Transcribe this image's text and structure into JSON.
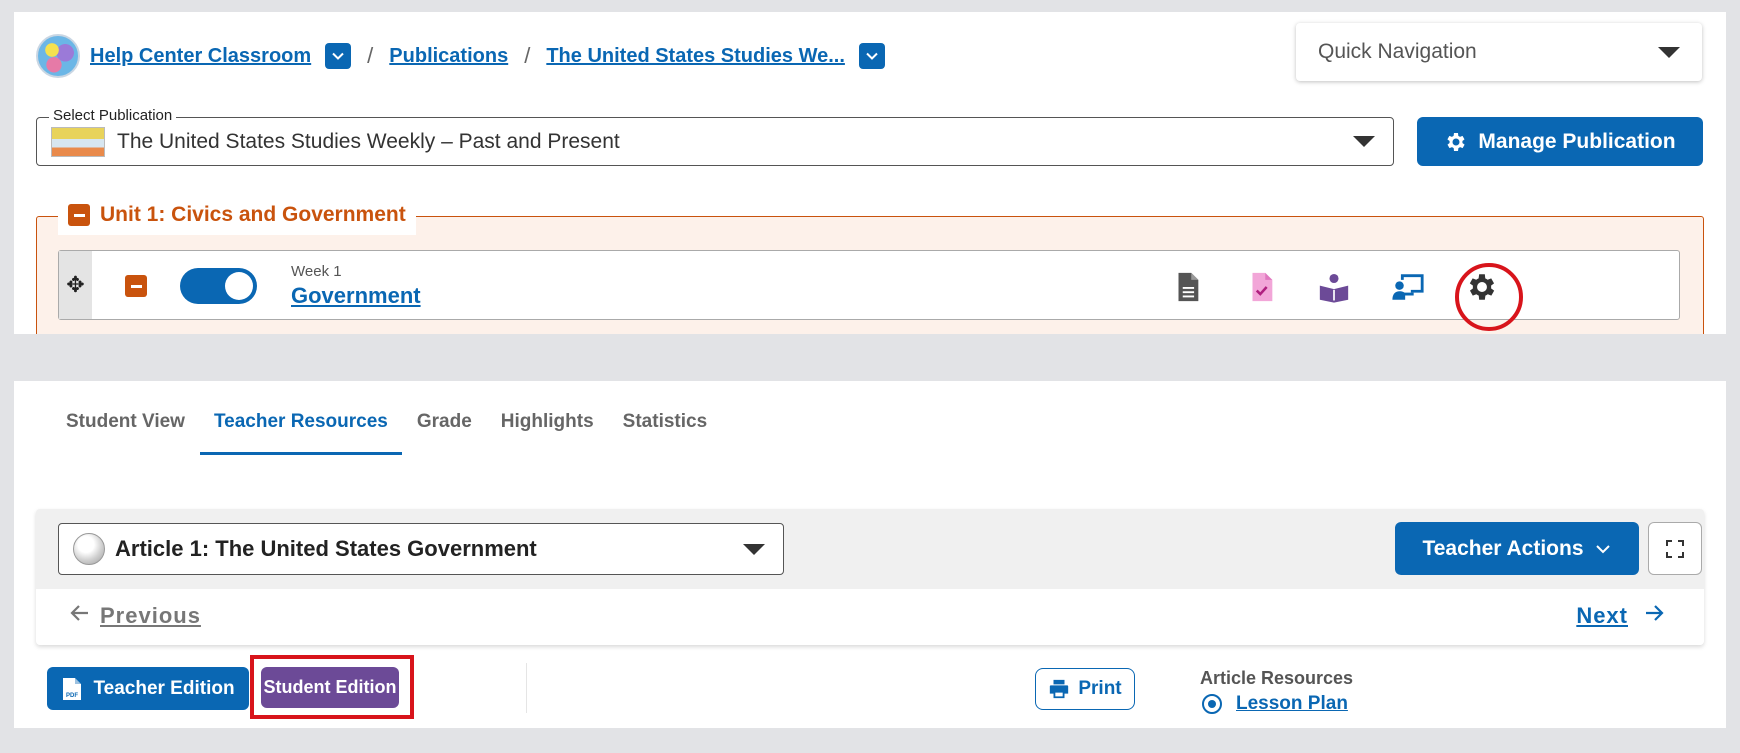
{
  "breadcrumb": {
    "classroom": "Help Center Classroom",
    "publications": "Publications",
    "publication": "The United States Studies We..."
  },
  "quick_navigation": {
    "label": "Quick Navigation"
  },
  "select_publication": {
    "legend": "Select Publication",
    "value": "The United States Studies Weekly – Past and Present"
  },
  "manage_publication": {
    "label": "Manage Publication"
  },
  "unit": {
    "title": "Unit 1: Civics and Government"
  },
  "week": {
    "label": "Week 1",
    "title": "Government",
    "toggle_on": true,
    "icons": [
      "document-icon",
      "assignment-check-icon",
      "student-reading-icon",
      "teacher-present-icon",
      "gear-icon"
    ]
  },
  "tabs": [
    {
      "label": "Student View",
      "active": false
    },
    {
      "label": "Teacher Resources",
      "active": true
    },
    {
      "label": "Grade",
      "active": false
    },
    {
      "label": "Highlights",
      "active": false
    },
    {
      "label": "Statistics",
      "active": false
    }
  ],
  "article": {
    "selected": "Article 1: The United States Government",
    "teacher_actions": "Teacher Actions",
    "previous": "Previous",
    "next": "Next"
  },
  "editions": {
    "teacher": "Teacher Edition",
    "student": "Student Edition"
  },
  "print": {
    "label": "Print"
  },
  "article_resources": {
    "title": "Article Resources",
    "items": [
      "Lesson Plan"
    ]
  },
  "colors": {
    "primary": "#0a67b3",
    "unit_accent": "#c9530d",
    "student_edition": "#6c4a97",
    "highlight": "#d8141b"
  }
}
